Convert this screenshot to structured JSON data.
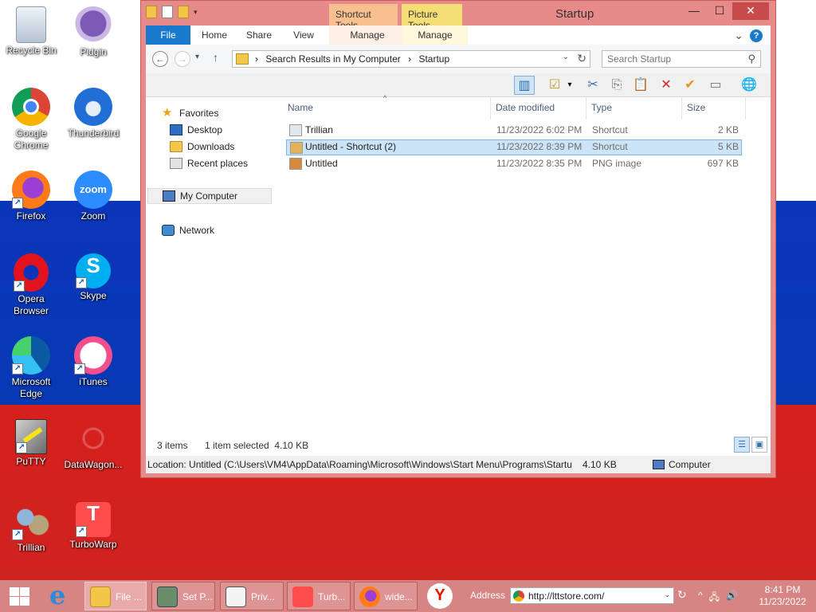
{
  "desktop": {
    "icons": [
      {
        "label": "Recycle Bin",
        "icon": "recycle-bin-icon"
      },
      {
        "label": "Pidgin",
        "icon": "pidgin-icon"
      },
      {
        "label": "Google Chrome",
        "icon": "chrome-icon"
      },
      {
        "label": "Thunderbird",
        "icon": "thunderbird-icon"
      },
      {
        "label": "Firefox",
        "icon": "firefox-icon"
      },
      {
        "label": "Zoom",
        "icon": "zoom-icon"
      },
      {
        "label": "Opera Browser",
        "icon": "opera-icon"
      },
      {
        "label": "Skype",
        "icon": "skype-icon"
      },
      {
        "label": "Microsoft Edge",
        "icon": "edge-icon"
      },
      {
        "label": "iTunes",
        "icon": "itunes-icon"
      },
      {
        "label": "PuTTY",
        "icon": "putty-icon"
      },
      {
        "label": "DataWagon...",
        "icon": "datawagon-icon"
      },
      {
        "label": "Trillian",
        "icon": "trillian-icon"
      },
      {
        "label": "TurboWarp",
        "icon": "turbowarp-icon"
      }
    ],
    "zoom_glyph": "zoom",
    "skype_glyph": "S",
    "turbowarp_glyph": "T",
    "shortcut_arrow": "↗"
  },
  "window": {
    "title": "Startup",
    "context_tabs": {
      "shortcut_tools": "Shortcut Tools",
      "picture_tools": "Picture Tools"
    },
    "ribbon_tabs": {
      "file": "File",
      "home": "Home",
      "share": "Share",
      "view": "View",
      "manage1": "Manage",
      "manage2": "Manage"
    },
    "help_label": "?",
    "collapse_glyph": "⌄",
    "controls": {
      "minimize": "—",
      "maximize": "☐",
      "close": "✕"
    },
    "nav": {
      "back": "←",
      "forward": "→",
      "recent": "▾",
      "up": "↑"
    },
    "breadcrumb": [
      "Search Results in My Computer",
      "Startup"
    ],
    "breadcrumb_sep": "›",
    "address_dropdown": "⌄",
    "refresh": "↻",
    "search_placeholder": "Search Startup",
    "search_glyph": "⚲",
    "toolbar": {
      "pane": "▥",
      "properties": "☑",
      "more": "▾",
      "cut": "✂",
      "copy": "⎘",
      "paste": "📋",
      "delete": "✕",
      "rename": "✔",
      "options": "▭",
      "globe": "🌐"
    },
    "nav_pane": {
      "favorites": "Favorites",
      "desktop": "Desktop",
      "downloads": "Downloads",
      "recent": "Recent places",
      "computer": "My Computer",
      "network": "Network"
    },
    "columns": {
      "name": "Name",
      "date": "Date modified",
      "type": "Type",
      "size": "Size"
    },
    "sort_glyph": "^",
    "files": [
      {
        "name": "Trillian",
        "date": "11/23/2022 6:02 PM",
        "type": "Shortcut",
        "size": "2 KB",
        "selected": false
      },
      {
        "name": "Untitled - Shortcut (2)",
        "date": "11/23/2022 8:39 PM",
        "type": "Shortcut",
        "size": "5 KB",
        "selected": true
      },
      {
        "name": "Untitled",
        "date": "11/23/2022 8:35 PM",
        "type": "PNG image",
        "size": "697 KB",
        "selected": false
      }
    ],
    "status": {
      "items": "3 items",
      "selected": "1 item selected  4.10 KB"
    },
    "view_buttons": {
      "details": "☰",
      "large": "▣"
    },
    "location": {
      "path": "Location: Untitled (C:\\Users\\VM4\\AppData\\Roaming\\Microsoft\\Windows\\Start Menu\\Programs\\Startu",
      "size": "4.10 KB",
      "zone": "Computer"
    }
  },
  "taskbar": {
    "buttons": [
      {
        "label": "File ...",
        "icon": "file-explorer-icon"
      },
      {
        "label": "Set P...",
        "icon": "set-program-icon"
      },
      {
        "label": "Priv...",
        "icon": "privacy-icon"
      },
      {
        "label": "Turb...",
        "icon": "turbowarp-task-icon"
      },
      {
        "label": "wide...",
        "icon": "firefox-task-icon"
      }
    ],
    "ie_glyph": "e",
    "yandex_glyph": "Y",
    "address_label": "Address",
    "url": "http://lttstore.com/",
    "url_dropdown": "⌄",
    "refresh": "↻",
    "tray": {
      "show_hidden": "^",
      "network": "🖧",
      "volume": "🔊"
    },
    "time": "8:41 PM",
    "date": "11/23/2022"
  },
  "colors": {
    "flag_white": "#ffffff",
    "flag_blue": "#0739b5",
    "flag_red": "#d6201c",
    "window_frame": "#e78a8a",
    "file_tab": "#1979ca",
    "selection": "#cce4f7"
  }
}
